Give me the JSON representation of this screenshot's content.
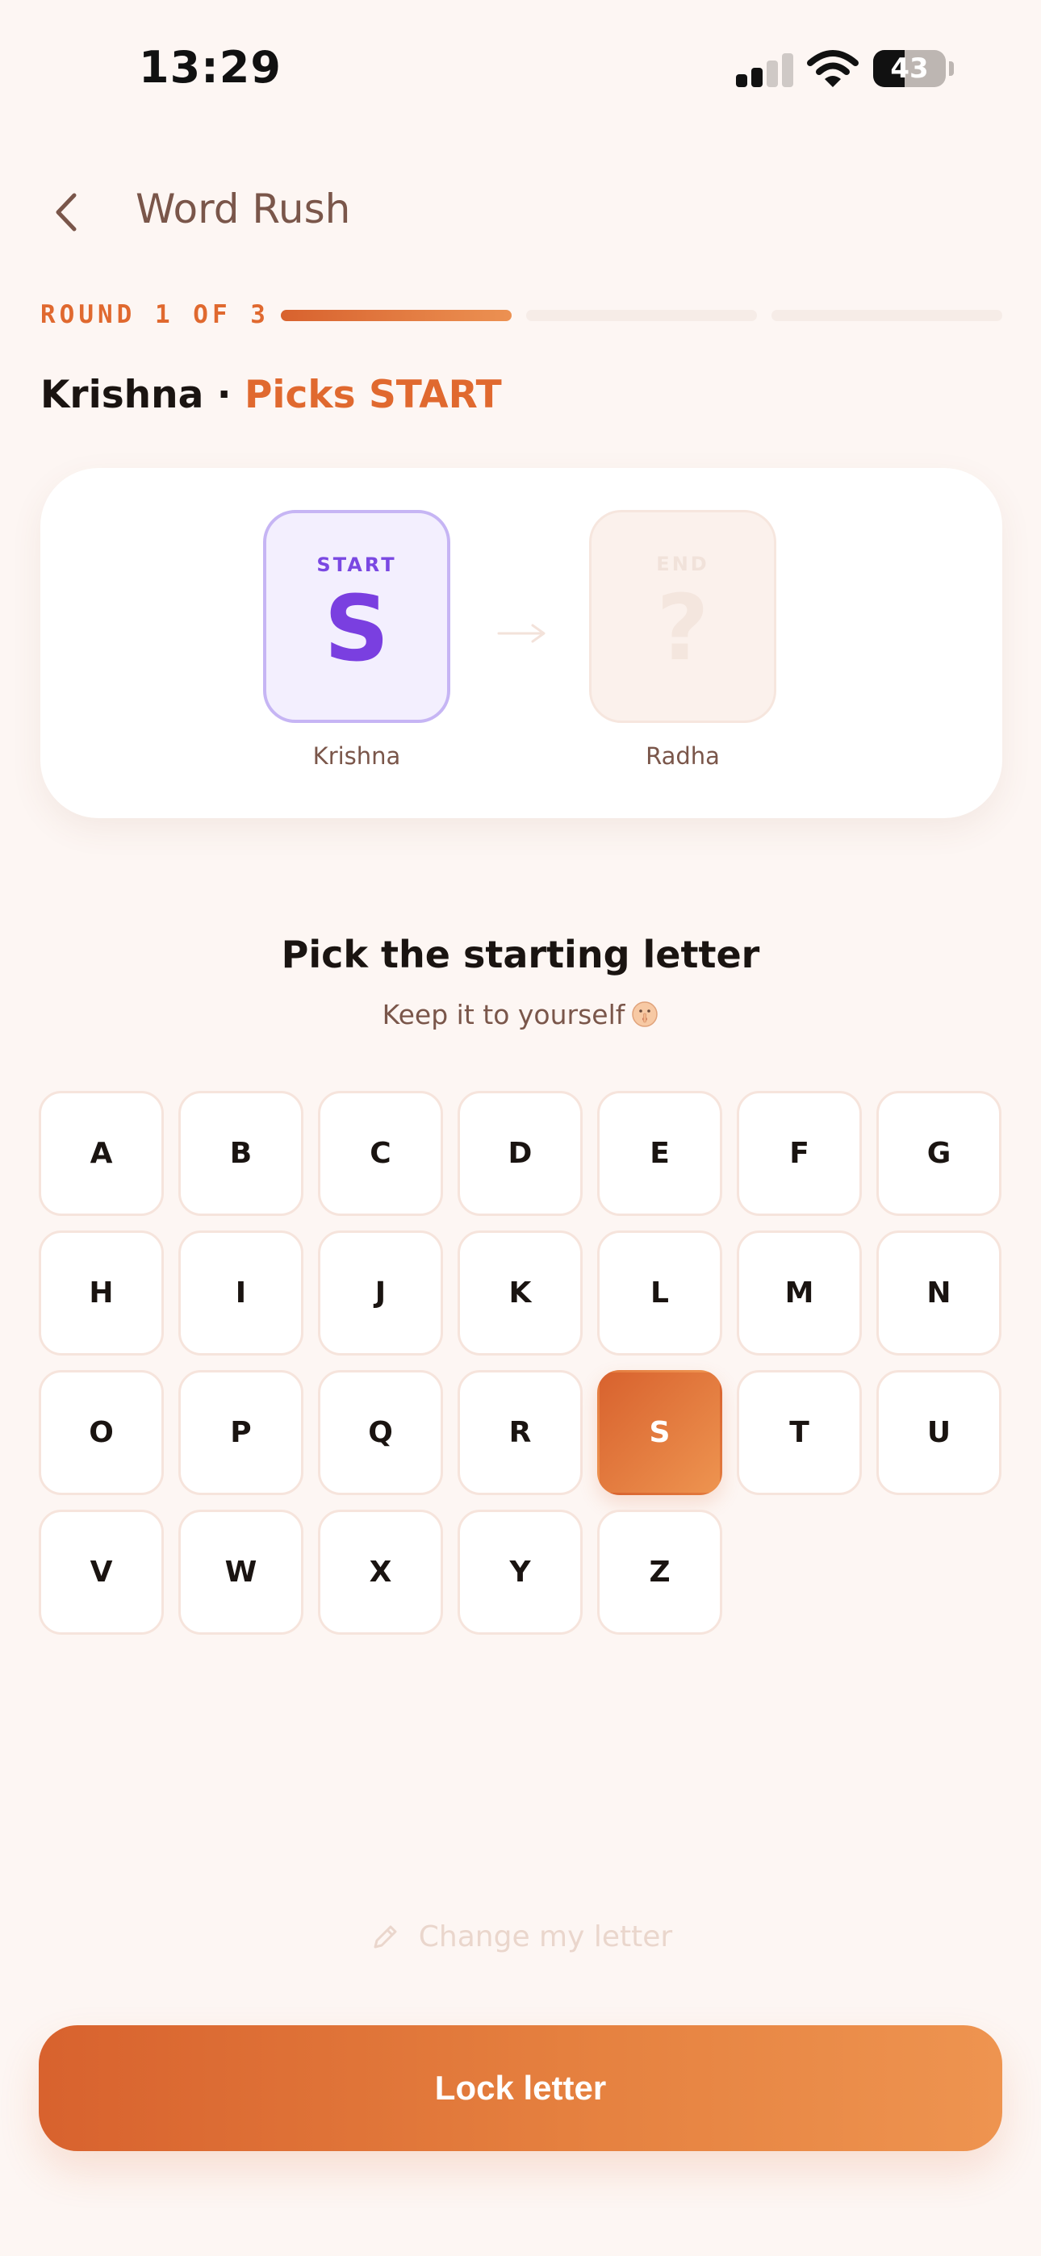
{
  "status_bar": {
    "time": "13:29",
    "battery_percent": 43,
    "battery_text": "43",
    "signal_bars_active": 2,
    "signal_bars_total": 4
  },
  "header": {
    "title": "Word Rush"
  },
  "round": {
    "label": "ROUND 1 OF 3",
    "current": 1,
    "total": 3
  },
  "player_line": {
    "name": "Krishna",
    "separator": "·",
    "role": "Picks START"
  },
  "card": {
    "start": {
      "caption": "START",
      "letter": "S",
      "owner": "Krishna"
    },
    "end": {
      "caption": "END",
      "letter": "?",
      "owner": "Radha"
    }
  },
  "prompt": {
    "title": "Pick the starting letter",
    "subtitle": "Keep it to yourself"
  },
  "letters": [
    "A",
    "B",
    "C",
    "D",
    "E",
    "F",
    "G",
    "H",
    "I",
    "J",
    "K",
    "L",
    "M",
    "N",
    "O",
    "P",
    "Q",
    "R",
    "S",
    "T",
    "U",
    "V",
    "W",
    "X",
    "Y",
    "Z"
  ],
  "selected_letter": "S",
  "actions": {
    "change_letter": "Change my letter",
    "lock_letter": "Lock letter"
  },
  "colors": {
    "background": "#fdf6f3",
    "accent": "#e0692f",
    "accent_gradient_start": "#d8622e",
    "accent_gradient_end": "#ee9450",
    "start_purple": "#7a3fe0",
    "muted_brown": "#7a564a"
  },
  "icons": {
    "back": "chevron-left-icon",
    "hush": "shushing-face-icon",
    "change": "pencil-icon"
  }
}
